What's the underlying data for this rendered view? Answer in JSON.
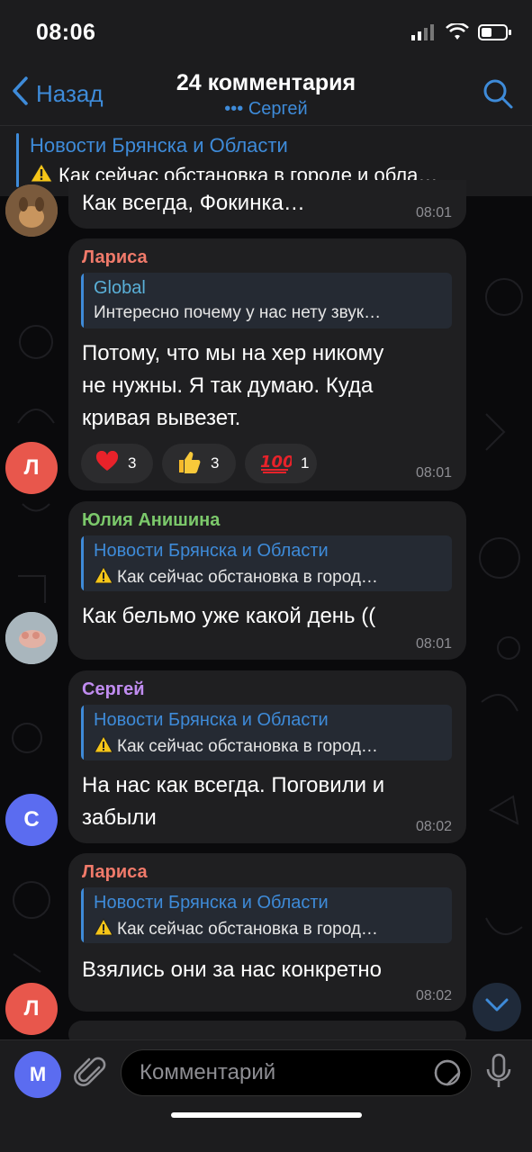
{
  "status_bar": {
    "time": "08:06"
  },
  "header": {
    "back_label": "Назад",
    "title": "24 комментария",
    "subtitle": "Сергей"
  },
  "pinned": {
    "channel": "Новости Брянска и Области",
    "text": "Как сейчас обстановка в городе и обла…"
  },
  "messages": [
    {
      "text": "Как всегда, Фокинка…",
      "time": "08:01"
    },
    {
      "author": "Лариса",
      "author_color": "#f07a6a",
      "avatar_letter": "Л",
      "reply_title": "Global",
      "reply_text": "Интересно почему у нас нету звук…",
      "text_lines": [
        "Потому, что мы на хер никому",
        "не нужны. Я так думаю. Куда",
        "кривая вывезет."
      ],
      "reactions": [
        {
          "icon": "heart-icon",
          "count": "3"
        },
        {
          "icon": "thumbs-up-icon",
          "count": "3"
        },
        {
          "icon": "hundred-icon",
          "count": "1"
        }
      ],
      "time": "08:01"
    },
    {
      "author": "Юлия Анишина",
      "author_color": "#7cc96b",
      "reply_title": "Новости Брянска и Области",
      "reply_text": "Как сейчас обстановка в город…",
      "text": "Как бельмо уже какой день ((",
      "time": "08:01"
    },
    {
      "author": "Сергей",
      "author_color": "#c08cf0",
      "avatar_letter": "С",
      "reply_title": "Новости Брянска и Области",
      "reply_text": "Как сейчас обстановка в город…",
      "text_lines": [
        "На нас как всегда. Поговили и",
        "забыли"
      ],
      "time": "08:02"
    },
    {
      "author": "Лариса",
      "author_color": "#f07a6a",
      "avatar_letter": "Л",
      "reply_title": "Новости Брянска и Области",
      "reply_text": "Как сейчас обстановка в город…",
      "text": "Взялись они за нас конкретно",
      "time": "08:02"
    }
  ],
  "input": {
    "avatar_letter": "М",
    "placeholder": "Комментарий"
  },
  "colors": {
    "accent": "#3e8bd9",
    "bubble": "#1f1f21",
    "avatar_larisa": "#e8574c",
    "avatar_sergey": "#5b6cf0",
    "avatar_me": "#5b6cf0"
  }
}
